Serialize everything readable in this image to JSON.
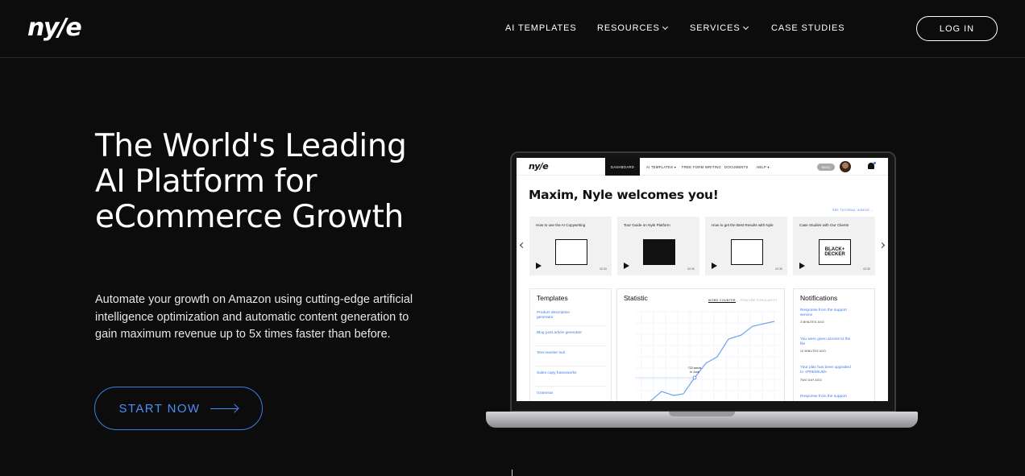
{
  "brand": {
    "logo_text": "ny/e"
  },
  "nav": {
    "items": [
      {
        "label": "AI TEMPLATES",
        "dropdown": false
      },
      {
        "label": "RESOURCES",
        "dropdown": true
      },
      {
        "label": "SERVICES",
        "dropdown": true
      },
      {
        "label": "CASE STUDIES",
        "dropdown": false
      }
    ],
    "login_label": "LOG IN"
  },
  "hero": {
    "title": "The World's Leading AI Platform for eCommerce Growth",
    "subtitle": "Automate your growth on Amazon using cutting-edge artificial intelligence optimization and automatic content generation to gain maximum revenue up to 5x times faster than before.",
    "cta_label": "START NOW"
  },
  "dashboard": {
    "logo_text": "ny/e",
    "tabs": [
      "DASHBOARD",
      "AI TEMPLATES ▾",
      "FREE FORM WRITING",
      "DOCUMENTS",
      "HELP ▾"
    ],
    "plan_badge": "BASIC",
    "welcome": "Maxim, Nyle welcomes you!",
    "tutorial_link": "SEE TUTORIAL VIDEOS →",
    "cards": [
      {
        "title": "How to use the AI Copywriting",
        "duration": "02:30"
      },
      {
        "title": "Tour Guide on Nyle Platform",
        "duration": "02:30"
      },
      {
        "title": "How to get the Best Results with Nyle",
        "duration": "02:30"
      },
      {
        "title": "Case Studies with Our Clients",
        "duration": "02:30",
        "thumb_text": "BLACK+ DECKER"
      }
    ],
    "templates": {
      "title": "Templates",
      "items": [
        "Product description generator",
        "Blog post article generator",
        "Text rewriter tool",
        "Sales copy frameworks",
        "Grammar"
      ]
    },
    "statistic": {
      "title": "Statistic",
      "tabs": [
        "WORD COUNTER",
        "FEATURE POPULARITY"
      ],
      "tooltip": "722 words in June"
    },
    "notifications": {
      "title": "Notifications",
      "items": [
        {
          "text": "Response from the support service",
          "time": "3 MINUTES AGO"
        },
        {
          "text": "You were given access to the file",
          "time": "10 MINUTES AGO"
        },
        {
          "text": "Your plan has been upgraded to «PREMIUM»",
          "time": "TWO DAY AGO"
        },
        {
          "text": "Response from the support",
          "time": ""
        }
      ]
    }
  }
}
